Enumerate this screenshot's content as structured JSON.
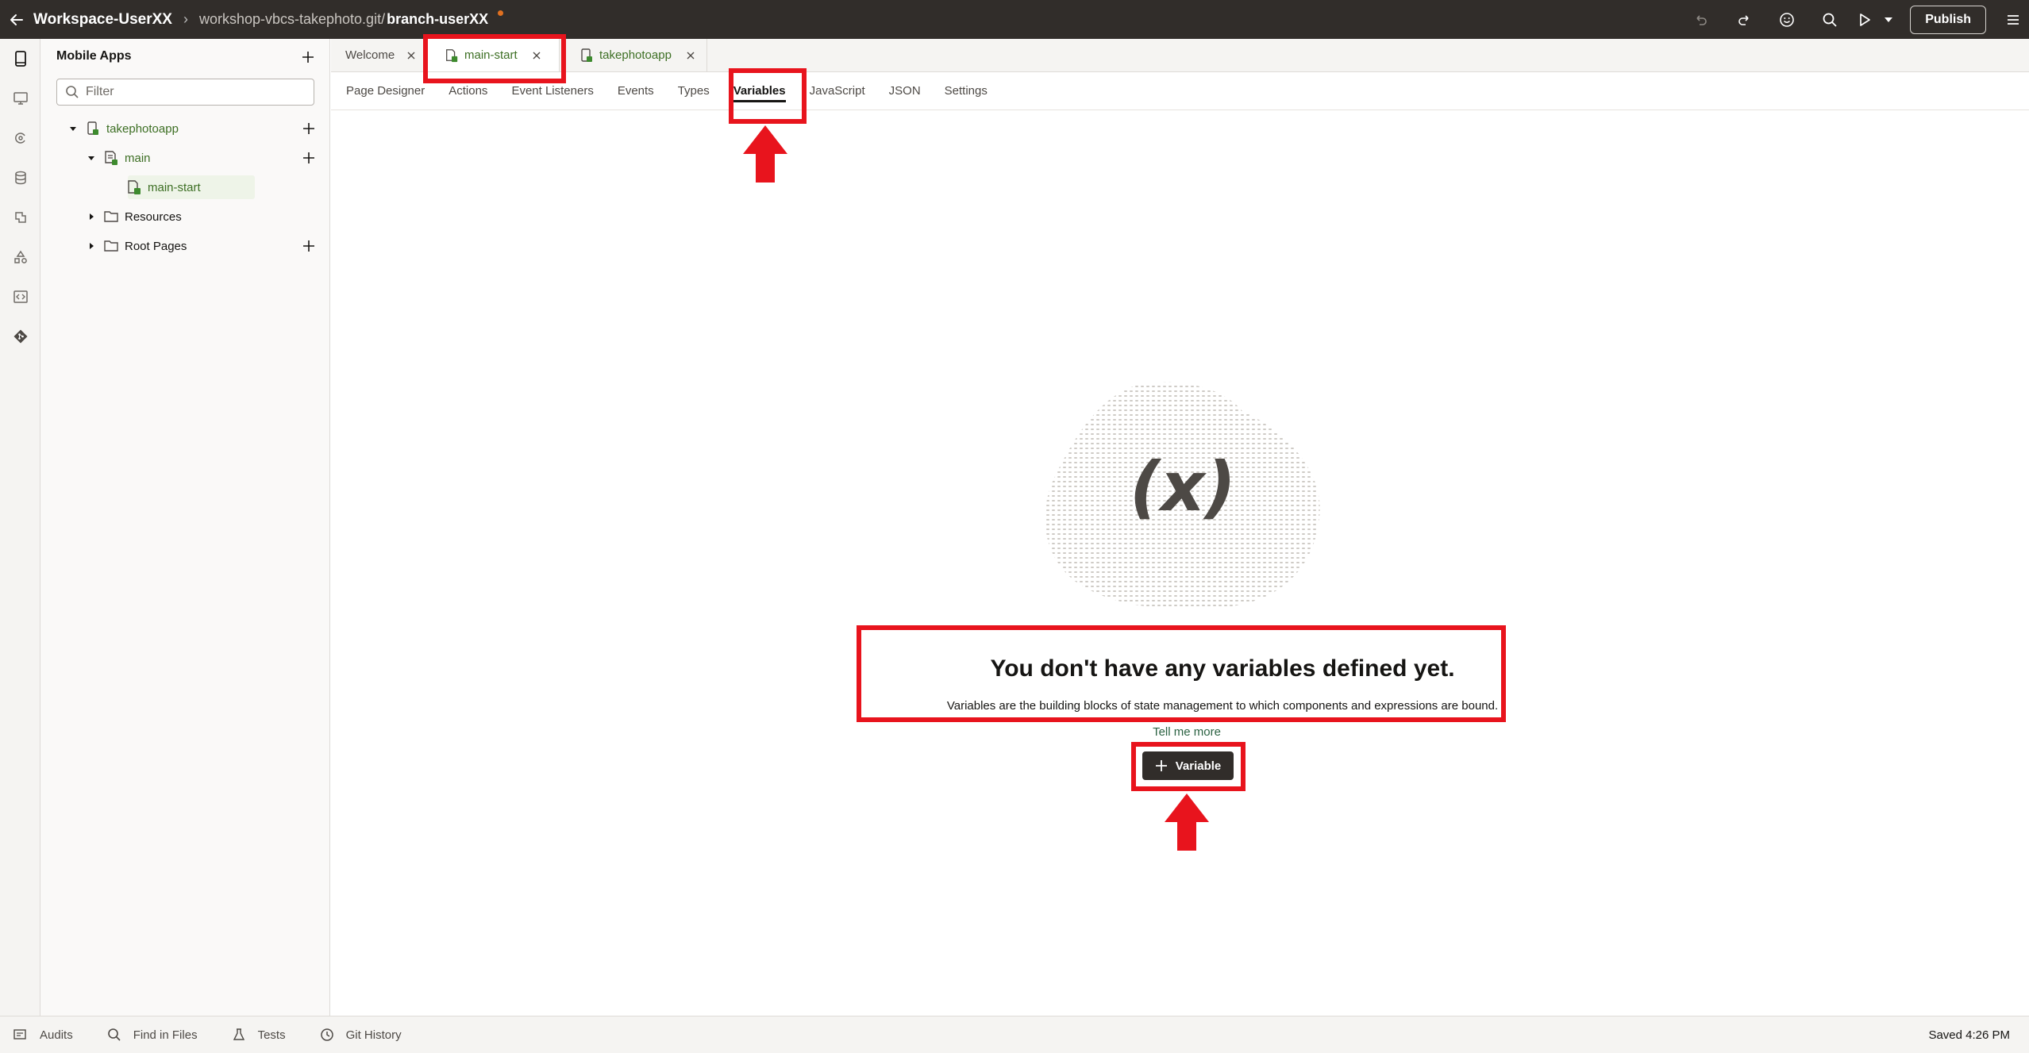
{
  "header": {
    "back_icon": "arrow-left-icon",
    "workspace_name": "Workspace-UserXX",
    "repo": "workshop-vbcs-takephoto.git/",
    "branch": "branch-userXX",
    "dirty_indicator_color": "#e07020",
    "actions": [
      "undo-icon",
      "redo-icon",
      "smile-icon",
      "search-icon",
      "run-icon",
      "chevron-down-icon"
    ],
    "publish_label": "Publish",
    "menu_icon": "hamburger-menu-icon"
  },
  "rail": {
    "items": [
      "mobile-apps-icon",
      "web-apps-icon",
      "services-icon",
      "business-objects-icon",
      "components-icon",
      "processes-icon",
      "source-icon",
      "git-icon"
    ]
  },
  "navigator": {
    "title": "Mobile Apps",
    "filter_placeholder": "Filter",
    "tree": [
      {
        "label": "takephotoapp",
        "expanded": true
      },
      {
        "label": "main",
        "expanded": true
      },
      {
        "label": "main-start",
        "selected": true
      },
      {
        "label": "Resources",
        "expanded": false
      },
      {
        "label": "Root Pages",
        "expanded": false
      }
    ]
  },
  "editor_tabs": [
    {
      "label": "Welcome"
    },
    {
      "label": "main-start",
      "active": true
    },
    {
      "label": "takephotoapp"
    }
  ],
  "sub_tabs": [
    "Page Designer",
    "Actions",
    "Event Listeners",
    "Events",
    "Types",
    "Variables",
    "JavaScript",
    "JSON",
    "Settings"
  ],
  "active_sub_tab": "Variables",
  "empty_state": {
    "illustration_text": "(x)",
    "title": "You don't have any variables defined yet.",
    "description": "Variables are the building blocks of state management to which components and expressions are bound.",
    "link": "Tell me more",
    "button": "Variable"
  },
  "status_bar": {
    "items": [
      {
        "label": "Audits",
        "icon": "audits-icon"
      },
      {
        "label": "Find in Files",
        "icon": "search-icon"
      },
      {
        "label": "Tests",
        "icon": "flask-icon"
      },
      {
        "label": "Git History",
        "icon": "clock-icon"
      }
    ],
    "saved": "Saved 4:26 PM"
  },
  "colors": {
    "header_bg": "#312d2a",
    "accent_green": "#3d6f24",
    "annotation_red": "#e8141d"
  }
}
